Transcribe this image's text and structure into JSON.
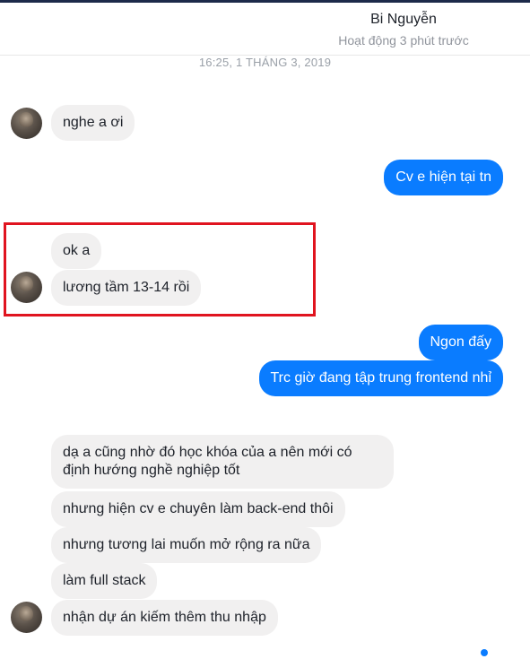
{
  "header": {
    "contact_name": "Bi Nguyễn",
    "status": "Hoạt động 3 phút trước"
  },
  "timestamp": "16:25, 1 THÁNG 3, 2019",
  "messages": [
    {
      "from": "them",
      "text": "nghe a ơi"
    },
    {
      "from": "me",
      "text": "Cv e hiện tại tn"
    },
    {
      "from": "them",
      "text": "ok a"
    },
    {
      "from": "them",
      "text": "lương tầm 13-14 rồi"
    },
    {
      "from": "me",
      "text": "Ngon đấy"
    },
    {
      "from": "me",
      "text": "Trc giờ đang tập trung frontend nhỉ"
    },
    {
      "from": "them",
      "text": "dạ a cũng nhờ đó học khóa của a nên mới có định hướng nghề nghiệp tốt"
    },
    {
      "from": "them",
      "text": "nhưng hiện cv e chuyên làm back-end thôi"
    },
    {
      "from": "them",
      "text": "nhưng tương lai muốn mở rộng ra nữa"
    },
    {
      "from": "them",
      "text": "làm full stack"
    },
    {
      "from": "them",
      "text": "nhận dự án kiếm thêm thu nhập"
    }
  ],
  "colors": {
    "incoming_bubble": "#f1f0f0",
    "outgoing_bubble": "#0a7cff",
    "highlight_box": "#e0141f"
  }
}
